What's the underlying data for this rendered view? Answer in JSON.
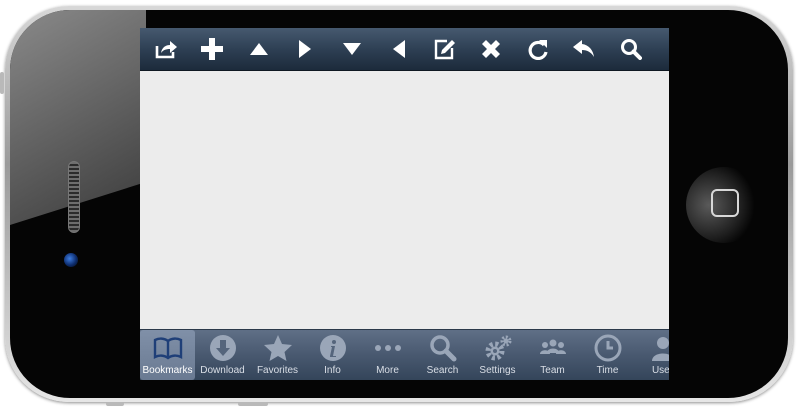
{
  "colors": {
    "toolbar": "#2e4054",
    "tabbar": "#4b5b72",
    "tab_icon": "#9aa6b8",
    "tab_icon_active": "#1f3f78",
    "screen_bg": "#ececec"
  },
  "toolbar": {
    "icons": [
      "share-icon",
      "plus-icon",
      "triangle-up-icon",
      "triangle-right-icon",
      "triangle-down-icon",
      "triangle-left-icon",
      "edit-icon",
      "close-icon",
      "refresh-icon",
      "reply-icon",
      "search-icon"
    ]
  },
  "tabbar": {
    "active": "Bookmarks",
    "tabs": [
      {
        "label": "Bookmarks",
        "icon": "book-icon"
      },
      {
        "label": "Download",
        "icon": "download-icon"
      },
      {
        "label": "Favorites",
        "icon": "star-icon"
      },
      {
        "label": "Info",
        "icon": "info-icon"
      },
      {
        "label": "More",
        "icon": "more-icon"
      },
      {
        "label": "Search",
        "icon": "search-icon"
      },
      {
        "label": "Settings",
        "icon": "gear-icon"
      },
      {
        "label": "Team",
        "icon": "team-icon"
      },
      {
        "label": "Time",
        "icon": "clock-icon"
      },
      {
        "label": "User",
        "icon": "user-icon"
      }
    ]
  }
}
